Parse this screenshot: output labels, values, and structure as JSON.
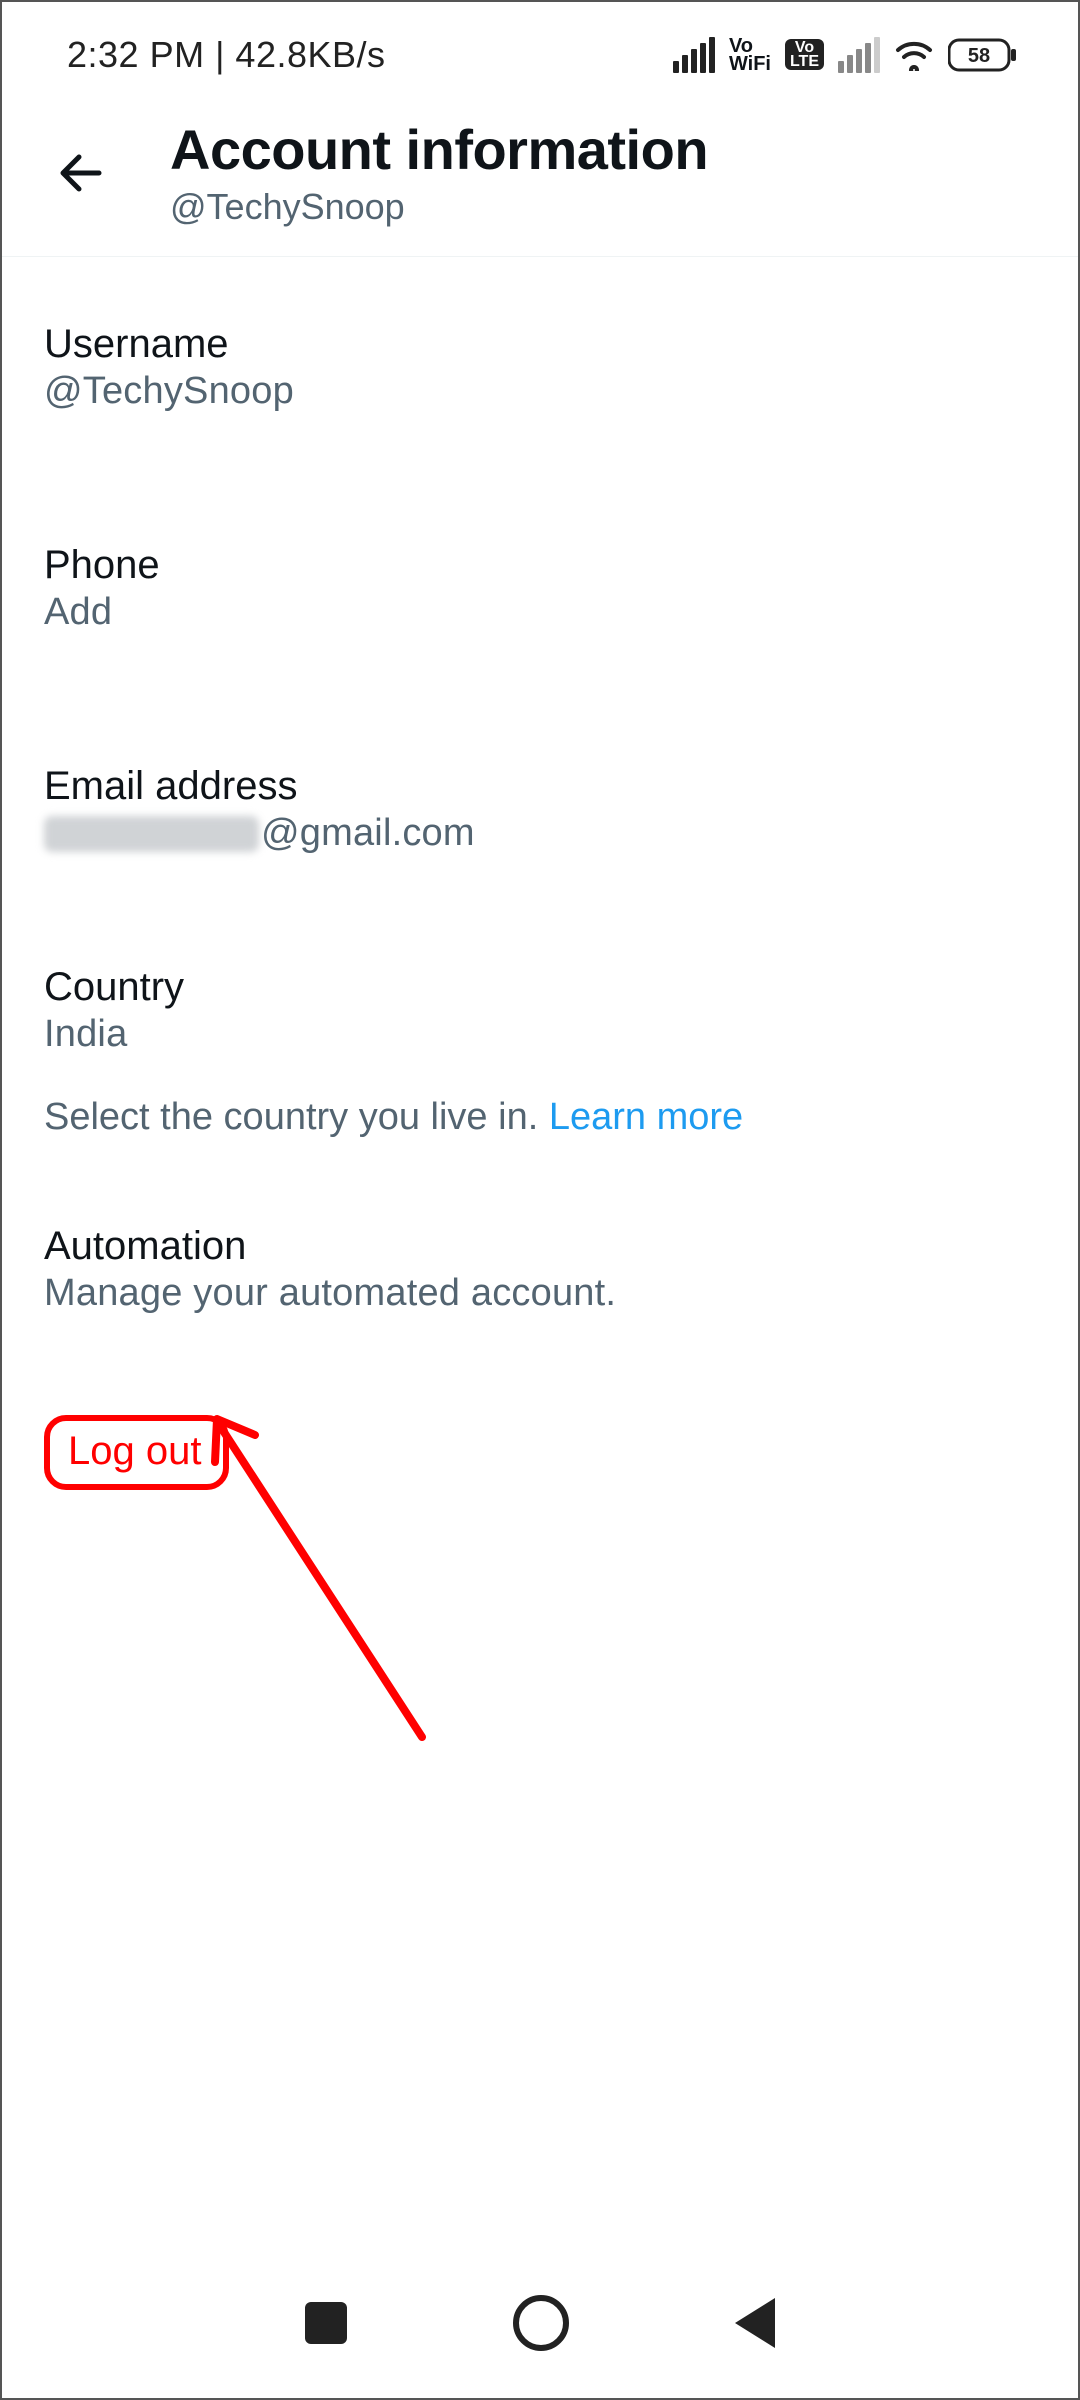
{
  "statusbar": {
    "left": "2:32 PM | 42.8KB/s",
    "battery": "58",
    "vo": "Vo",
    "wifi_label": "WiFi",
    "lte_vo": "Vo",
    "lte": "LTE"
  },
  "header": {
    "title": "Account information",
    "handle": "@TechySnoop"
  },
  "items": {
    "username": {
      "label": "Username",
      "value": "@TechySnoop"
    },
    "phone": {
      "label": "Phone",
      "value": "Add"
    },
    "email": {
      "label": "Email address",
      "suffix": "@gmail.com"
    },
    "country": {
      "label": "Country",
      "value": "India",
      "desc_prefix": "Select the country you live in. ",
      "learn_more": "Learn more"
    },
    "automation": {
      "label": "Automation",
      "value": "Manage your automated account."
    }
  },
  "logout": "Log out"
}
